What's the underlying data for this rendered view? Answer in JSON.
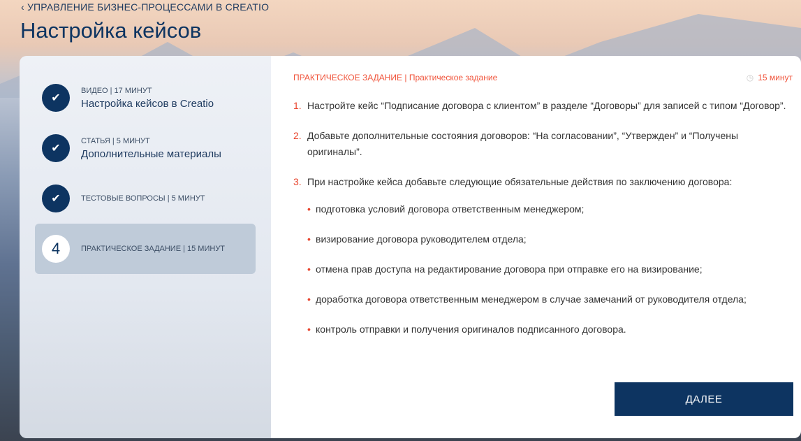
{
  "header": {
    "back_link": "УПРАВЛЕНИЕ БИЗНЕС-ПРОЦЕССАМИ В CREATIO",
    "title": "Настройка кейсов"
  },
  "steps": [
    {
      "meta": "ВИДЕО | 17 МИНУТ",
      "name": "Настройка кейсов в Creatio",
      "status": "done"
    },
    {
      "meta": "СТАТЬЯ | 5 МИНУТ",
      "name": "Дополнительные материалы",
      "status": "done"
    },
    {
      "meta": "ТЕСТОВЫЕ ВОПРОСЫ | 5 МИНУТ",
      "name": "",
      "status": "done"
    },
    {
      "number": "4",
      "meta": "ПРАКТИЧЕСКОЕ ЗАДАНИЕ | 15 МИНУТ",
      "name": "",
      "status": "active"
    }
  ],
  "content": {
    "label": "ПРАКТИЧЕСКОЕ ЗАДАНИЕ | Практическое задание",
    "duration": "15 минут",
    "items": [
      {
        "n": "1.",
        "text": "Настройте кейс “Подписание договора с клиентом” в разделе “Договоры” для записей с типом “Договор”."
      },
      {
        "n": "2.",
        "text": "Добавьте дополнительные состояния договоров: “На согласовании”, “Утвержден” и “Получены оригиналы”."
      },
      {
        "n": "3.",
        "text": "При настройке кейса добавьте следующие обязательные действия по заключению договора:"
      }
    ],
    "bullets": [
      "подготовка условий договора ответственным менеджером;",
      "визирование договора руководителем отдела;",
      "отмена прав доступа на редактирование договора при отправке его на визирование;",
      "доработка договора ответственным менеджером в случае замечаний от руководителя отдела;",
      "контроль отправки и получения оригиналов подписанного договора."
    ],
    "next_label": "ДАЛЕЕ"
  },
  "colors": {
    "brand": "#0d3461",
    "accent": "#f0533a"
  }
}
